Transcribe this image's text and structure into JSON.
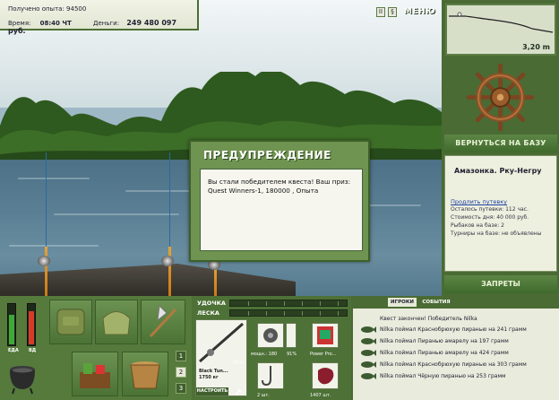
{
  "info": {
    "exp_label": "Получено опыта:",
    "exp_value": "94500",
    "time_label": "Время:",
    "time_value": "08:40 ЧТ",
    "money_label": "Деньги:",
    "money_value": "249 480 097 руб."
  },
  "topbar": {
    "btn_info": "i",
    "btn_pause": "II",
    "btn_sound": "§",
    "menu_label": "МЕНЮ"
  },
  "depth": {
    "value": "3,20 m"
  },
  "nav": {
    "return_label": "ВЕРНУТЬСЯ НА БАЗУ",
    "bans_label": "ЗАПРЕТЫ"
  },
  "location": {
    "name": "Амазонка. Рку-Негру",
    "extend_link": "Продлить путевку",
    "days_left": "Осталось путевки: 112 час.",
    "day_cost": "Стоимость дня: 40 000 руб.",
    "fishers": "Рыбаков на базе: 2",
    "tournaments": "Турниры на базе: не объявлены"
  },
  "dialog": {
    "title": "ПРЕДУПРЕЖДЕНИЕ",
    "message": "Вы стали победителем квеста! Ваш приз: Quest Winners-1, 180000 , Опыта"
  },
  "gauges": {
    "left_label": "ЕДА",
    "right_label": "ВД",
    "left_level": 0.75,
    "right_level": 0.85,
    "left_color": "#3fa83a",
    "right_color": "#d83a2a"
  },
  "slots": {
    "num1": "1",
    "num2": "2",
    "num3": "3"
  },
  "tackle": {
    "rod_label": "УДОЧКА",
    "line_label": "ЛЕСКА",
    "rod_name": "Black Tun...",
    "rod_weight": "1750 кг",
    "rod_pct": "86%",
    "reel_label": "мощн.: 180",
    "reel_pct": "91%",
    "bait_label": "Power Pro...",
    "hook_count": "2 шт.",
    "lure_count": "1407 шт.",
    "setup_label": "НАСТРОИТЬ"
  },
  "chat": {
    "tab_players": "ИГРОКИ",
    "tab_events": "СОБЫТИЯ",
    "quest_line": "Квест закончен! Победитель Nilka",
    "catches": [
      "Nilka поймал Краснобрюхую пиранью на 241 грамм",
      "Nilka поймал Пиранью амарелу на 197 грамм",
      "Nilka поймал Пиранью амарелу на 424 грамм",
      "Nilka поймал Краснобрюхую пиранью на 303 грамм",
      "Nilka поймал Чёрную пиранью на 253 грамм"
    ]
  }
}
